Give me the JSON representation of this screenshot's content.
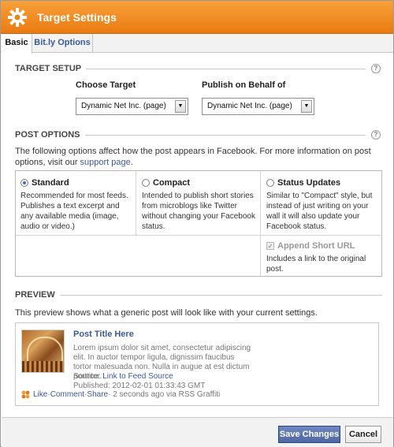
{
  "window": {
    "title": "Target Settings"
  },
  "tabs": [
    {
      "label": "Basic",
      "active": true
    },
    {
      "label": "Bit.ly Options",
      "active": false
    }
  ],
  "target_setup": {
    "title": "TARGET SETUP",
    "help": "?",
    "choose_target": {
      "label": "Choose Target",
      "value": "Dynamic Net Inc. (page)"
    },
    "publish_behalf": {
      "label": "Publish on Behalf of",
      "value": "Dynamic Net Inc. (page)"
    }
  },
  "post_options": {
    "title": "POST OPTIONS",
    "help": "?",
    "intro_text": "The following options affect how the post appears in Facebook. For more information on post options, visit our ",
    "intro_link": "support page",
    "intro_end": ".",
    "options": [
      {
        "label": "Standard",
        "selected": true,
        "desc": "Recommended for most feeds. Publishes a text excerpt and any available media (image, audio or video.)"
      },
      {
        "label": "Compact",
        "selected": false,
        "desc": "Intended to publish short stories from microblogs like Twitter without changing your Facebook status."
      },
      {
        "label": "Status Updates",
        "selected": false,
        "desc": "Similar to \"Compact\" style, but instead of just writing on your wall it will also update your Facebook status."
      }
    ],
    "append_short_url": {
      "label": "Append Short URL",
      "checked": true,
      "disabled": true,
      "desc": "Includes a link to the original post."
    }
  },
  "preview": {
    "title": "PREVIEW",
    "intro": "This preview shows what a generic post will look like with your current settings.",
    "post": {
      "title": "Post Title Here",
      "body": "Lorem ipsum dolor sit amet, consectetur adipiscing elit. In auctor tempor ligula, dignissim faucibus tortor malesuada non. Nulla in augue at est dictum porttitor.",
      "source_label": "Source: ",
      "source_link": "Link to Feed Source",
      "published": "Published: 2012-02-01 01:33:43 GMT",
      "like": "Like",
      "comment": "Comment",
      "share": "Share",
      "sep": " · ",
      "meta": " · 2 seconds ago via RSS Graffiti"
    }
  },
  "footer": {
    "save_label": "Save Changes",
    "cancel_label": "Cancel"
  },
  "colors": {
    "titlebar": "#f08a22",
    "link": "#3b5998",
    "save_button": "#5b74ad"
  }
}
